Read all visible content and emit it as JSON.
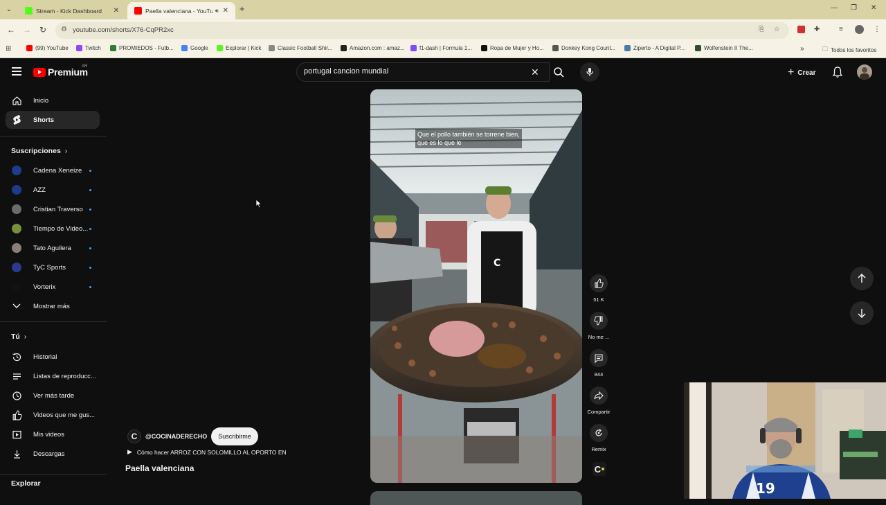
{
  "browser": {
    "tabs": [
      {
        "title": "Stream - Kick Dashboard",
        "favicon_color": "#53fc18",
        "active": false
      },
      {
        "title": "Paella valenciana - YouTube",
        "favicon_color": "#ff0000",
        "active": true
      }
    ],
    "url": "youtube.com/shorts/X76-CqPR2xc",
    "bookmarks": [
      {
        "label": "(99) YouTube",
        "color": "#ff0000"
      },
      {
        "label": "Twitch",
        "color": "#9146ff"
      },
      {
        "label": "PROMIEDOS - Futb...",
        "color": "#2e7d32"
      },
      {
        "label": "Google",
        "color": "#4285f4"
      },
      {
        "label": "Explorar | Kick",
        "color": "#53fc18"
      },
      {
        "label": "Classic Football Shir...",
        "color": "#888888"
      },
      {
        "label": "Amazon.com : amaz...",
        "color": "#222222"
      },
      {
        "label": "f1-dash | Formula 1...",
        "color": "#7c4dff"
      },
      {
        "label": "Ropa de Mujer y Ho...",
        "color": "#111111"
      },
      {
        "label": "Donkey Kong Count...",
        "color": "#555555"
      },
      {
        "label": "Ziperto - A Digital P...",
        "color": "#4a7aa8"
      },
      {
        "label": "Wolfenstein II The...",
        "color": "#2f4f2f"
      }
    ],
    "all_bookmarks": "Todos los favoritos"
  },
  "masthead": {
    "logo_text": "Premium",
    "country": "AR",
    "search_value": "portugal cancion mundial",
    "create_label": "Crear"
  },
  "sidebar": {
    "main": [
      {
        "label": "Inicio",
        "icon": "home-icon"
      },
      {
        "label": "Shorts",
        "icon": "shorts-icon",
        "selected": true
      }
    ],
    "subs_header": "Suscripciones",
    "subscriptions": [
      {
        "label": "Cadena Xeneize",
        "color": "#1d3c8f"
      },
      {
        "label": "AZZ",
        "color": "#1e3a8a"
      },
      {
        "label": "Cristian Traverso",
        "color": "#6b6b6b"
      },
      {
        "label": "Tiempo de Video...",
        "color": "#7a8f3a"
      },
      {
        "label": "Tato Aguilera",
        "color": "#8a7f78"
      },
      {
        "label": "TyC Sports",
        "color": "#2a3a8c"
      },
      {
        "label": "Vorterix",
        "color": "#111111"
      }
    ],
    "show_more": "Mostrar más",
    "you_header": "Tú",
    "you_items": [
      {
        "label": "Historial",
        "icon": "history-icon"
      },
      {
        "label": "Listas de reproducc...",
        "icon": "playlist-icon"
      },
      {
        "label": "Ver más tarde",
        "icon": "clock-icon"
      },
      {
        "label": "Videos que me gus...",
        "icon": "like-icon"
      },
      {
        "label": "Mis videos",
        "icon": "my-videos-icon"
      },
      {
        "label": "Descargas",
        "icon": "download-icon"
      }
    ],
    "explore_header": "Explorar"
  },
  "short": {
    "caption_lines": [
      "Que el pollo también se torrene bien,",
      "que es lo que le"
    ],
    "channel_handle": "@COCINADERECHO",
    "subscribe_label": "Suscribirme",
    "linked_video": "Cómo hacer ARROZ CON SOLOMILLO AL OPORTO EN",
    "title": "Paella valenciana",
    "likes": "51 K",
    "dislike_label": "No me ...",
    "comments": "844",
    "share_label": "Compartir",
    "remix_label": "Remix"
  }
}
